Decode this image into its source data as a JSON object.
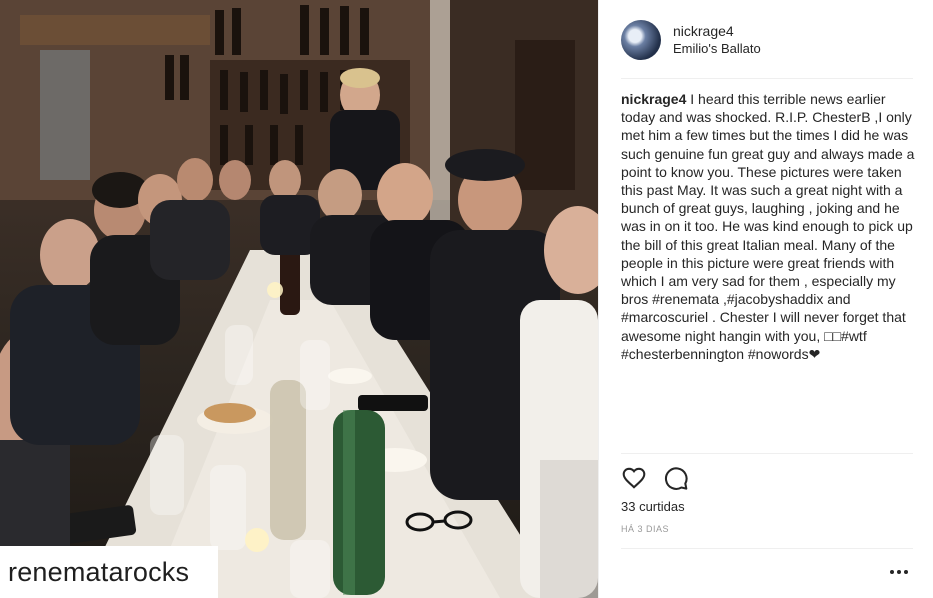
{
  "post": {
    "username": "nickrage4",
    "location": "Emilio's Ballato",
    "caption_user": "nickrage4",
    "caption_text": "I heard this terrible news earlier today and was shocked. R.I.P. ChesterB ,I only met him a few times but the times I did he was such genuine fun great guy and always made a point to know you. These pictures were taken this past May. It was such a great night with a bunch of great guys, laughing , joking and he was in on it too. He was kind enough to pick up the bill of this great Italian meal. Many of the people in this picture were great friends with which I am very sad for them , especially my bros #renemata ,#jacobyshaddix and #marcoscuriel . Chester I will never forget that awesome night hangin with you, □□#wtf #chesterbennington #nowords❤",
    "likes": "33 curtidas",
    "timestamp": "HÁ 3 DIAS"
  },
  "photo": {
    "watermark": "renematarocks"
  },
  "icons": {
    "like": "heart-icon",
    "comment": "comment-icon",
    "more": "more-options-icon"
  },
  "colors": {
    "text": "#262626",
    "muted": "#999999",
    "divider": "#efefef"
  }
}
